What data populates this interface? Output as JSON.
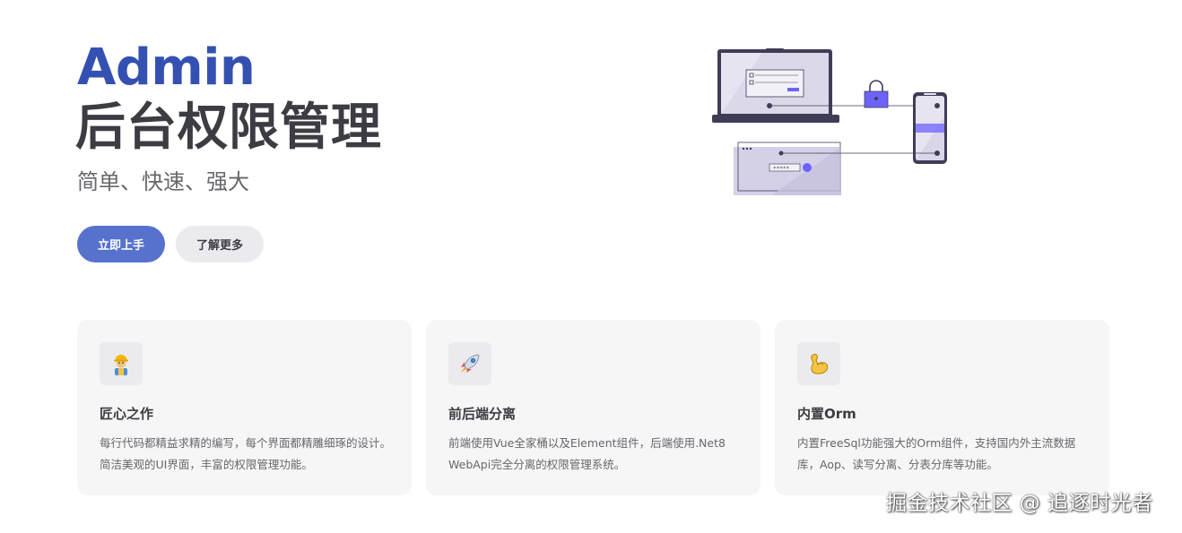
{
  "hero": {
    "name": "Admin",
    "text": "后台权限管理",
    "tagline": "简单、快速、强大",
    "actions": [
      {
        "label": "立即上手",
        "theme": "brand"
      },
      {
        "label": "了解更多",
        "theme": "alt"
      }
    ]
  },
  "features": [
    {
      "icon": "construction-worker-icon",
      "title": "匠心之作",
      "details": "每行代码都精益求精的编写，每个界面都精雕细琢的设计。简洁美观的UI界面，丰富的权限管理功能。"
    },
    {
      "icon": "rocket-icon",
      "title": "前后端分离",
      "details": "前端使用Vue全家桶以及Element组件，后端使用.Net8 WebApi完全分离的权限管理系统。"
    },
    {
      "icon": "flexed-biceps-icon",
      "title": "内置Orm",
      "details": "内置FreeSql功能强大的Orm组件，支持国内外主流数据库，Aop、读写分离、分表分库等功能。"
    }
  ],
  "watermark": "掘金技术社区 @ 追逐时光者",
  "colors": {
    "brand": "#3451b2",
    "button_brand": "#5672cd",
    "illustration_purple": "#6c63ff"
  }
}
